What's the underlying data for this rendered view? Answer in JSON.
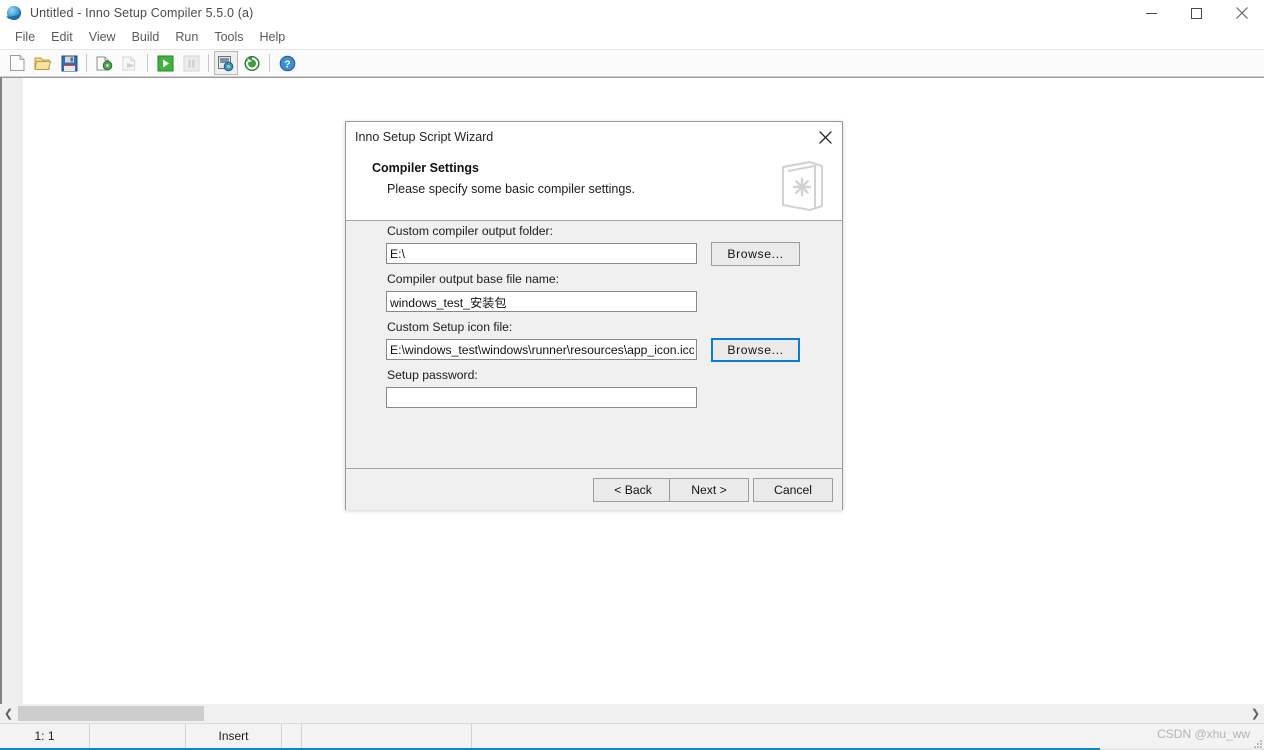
{
  "window": {
    "title": "Untitled - Inno Setup Compiler 5.5.0 (a)",
    "icon": "inno-setup-globe-icon",
    "controls": {
      "minimize": "minimize-icon",
      "maximize": "maximize-icon",
      "close": "close-icon"
    }
  },
  "menubar": {
    "items": [
      {
        "label": "File"
      },
      {
        "label": "Edit"
      },
      {
        "label": "View"
      },
      {
        "label": "Build"
      },
      {
        "label": "Run"
      },
      {
        "label": "Tools"
      },
      {
        "label": "Help"
      }
    ]
  },
  "toolbar": {
    "buttons": [
      {
        "name": "new-file-icon",
        "enabled": true
      },
      {
        "name": "open-file-icon",
        "enabled": true
      },
      {
        "name": "save-file-icon",
        "enabled": true
      },
      {
        "name": "compile-icon",
        "enabled": true
      },
      {
        "name": "stop-compile-icon",
        "enabled": false
      },
      {
        "name": "run-icon",
        "enabled": true
      },
      {
        "name": "pause-icon",
        "enabled": false
      },
      {
        "name": "target-setup-icon",
        "enabled": true,
        "active": true
      },
      {
        "name": "reload-icon",
        "enabled": true
      },
      {
        "name": "help-icon",
        "enabled": true
      }
    ]
  },
  "dialog": {
    "title": "Inno Setup Script Wizard",
    "close_icon": "close-icon",
    "header": {
      "title": "Compiler Settings",
      "subtitle": "Please specify some basic compiler settings.",
      "icon": "wizard-book-icon"
    },
    "fields": [
      {
        "label": "Custom compiler output folder:",
        "value": "E:\\",
        "placeholder": "",
        "has_browse": true,
        "browse_label": "Browse...",
        "browse_focused": false
      },
      {
        "label": "Compiler output base file name:",
        "value": "windows_test_安装包",
        "placeholder": "",
        "has_browse": false
      },
      {
        "label": "Custom Setup icon file:",
        "value": "E:\\windows_test\\windows\\runner\\resources\\app_icon.ico",
        "placeholder": "",
        "has_browse": true,
        "browse_label": "Browse...",
        "browse_focused": true
      },
      {
        "label": "Setup password:",
        "value": "",
        "placeholder": "",
        "has_browse": false
      }
    ],
    "footer": {
      "back_label": "< Back",
      "next_label": "Next >",
      "cancel_label": "Cancel"
    }
  },
  "statusbar": {
    "cursor_position": "1:  1",
    "insert_mode": "Insert",
    "watermark": "CSDN @xhu_ww"
  },
  "colors": {
    "accent": "#1187c4",
    "focus_border": "#0a7bd4",
    "dialog_bg": "#f0f0f0",
    "toolbar_bg": "#fbfbfb"
  }
}
